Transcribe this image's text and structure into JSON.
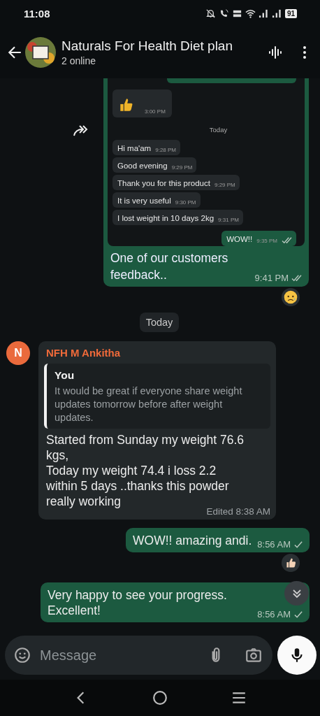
{
  "status_bar": {
    "time": "11:08",
    "battery": "91"
  },
  "header": {
    "title": "Naturals For Health Diet plan",
    "subtitle": "2 online"
  },
  "messages": [
    {
      "kind": "image",
      "forwarded": true,
      "screenshot": [
        {
          "kind": "cut_out"
        },
        {
          "kind": "thumb_in",
          "time": "3:00 PM"
        },
        {
          "kind": "date",
          "text": "Today"
        },
        {
          "kind": "in",
          "text": "Hi ma'am",
          "time": "9:28 PM"
        },
        {
          "kind": "in",
          "text": "Good evening",
          "time": "9:29 PM"
        },
        {
          "kind": "in",
          "text": "Thank you for this product",
          "time": "9:29 PM"
        },
        {
          "kind": "in",
          "text": "It is very useful",
          "time": "9:30 PM"
        },
        {
          "kind": "in",
          "text": "I lost weight in 10 days 2kg",
          "time": "9:31 PM"
        },
        {
          "kind": "out",
          "text": "WOW!!",
          "time": "9:35 PM",
          "delivered": true
        }
      ],
      "caption": "One of our customers feedback..",
      "time": "9:41 PM",
      "delivered": true,
      "reaction": {
        "kind": "sad"
      }
    },
    {
      "kind": "date",
      "text": "Today"
    },
    {
      "kind": "in",
      "avatar": "N",
      "sender": "NFH M Ankitha",
      "quote": {
        "author": "You",
        "text": "It would be great if everyone share weight updates tomorrow before after weight updates."
      },
      "text": "Started from Sunday my weight 76.6 kgs,\nToday my weight 74.4 i loss 2.2 within 5 days ..thanks this powder really working",
      "edited_label": "Edited",
      "time": "8:38 AM"
    },
    {
      "kind": "out",
      "text": "WOW!! amazing andi.",
      "time": "8:56 AM",
      "delivered": false,
      "reaction": {
        "kind": "thumbs_up"
      }
    },
    {
      "kind": "out",
      "text": "Very happy to see your progress.\nExcellent!",
      "time": "8:56 AM",
      "delivered": false
    }
  ],
  "composer": {
    "placeholder": "Message"
  }
}
